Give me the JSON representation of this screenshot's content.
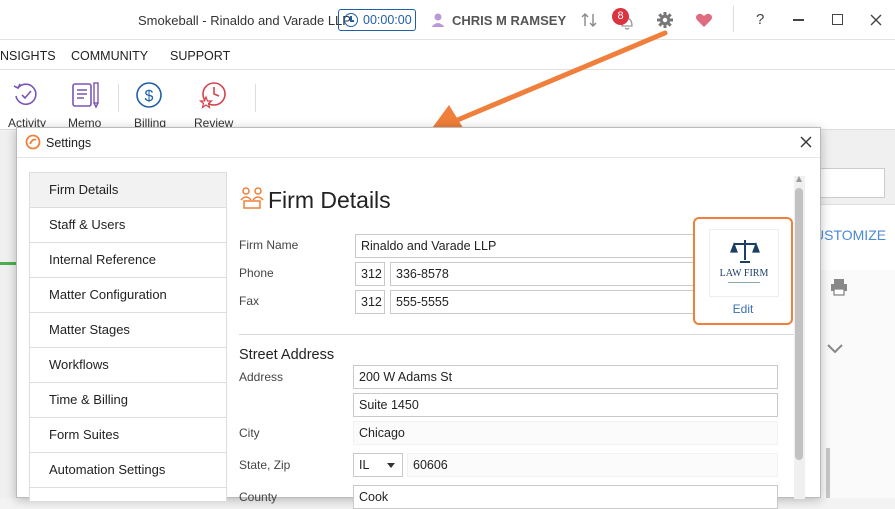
{
  "app": {
    "title": "Smokeball  - Rinaldo and Varade LLP",
    "timer": "00:00:00",
    "user": "CHRIS M RAMSEY",
    "notification_count": "8",
    "help": "?"
  },
  "menu": {
    "items": [
      "NSIGHTS",
      "COMMUNITY",
      "SUPPORT"
    ]
  },
  "ribbon": {
    "items": [
      "Activity",
      "Memo",
      "Billing",
      "Review"
    ]
  },
  "background": {
    "customize": "USTOMIZE"
  },
  "dialog": {
    "title": "Settings",
    "sidebar": [
      "Firm Details",
      "Staff & Users",
      "Internal Reference",
      "Matter Configuration",
      "Matter Stages",
      "Workflows",
      "Time & Billing",
      "Form Suites",
      "Automation Settings"
    ],
    "heading": "Firm Details",
    "labels": {
      "firm_name": "Firm Name",
      "phone": "Phone",
      "fax": "Fax",
      "street_address": "Street Address",
      "address": "Address",
      "city": "City",
      "state_zip": "State, Zip",
      "county": "County"
    },
    "values": {
      "firm_name": "Rinaldo and Varade LLP",
      "phone_area": "312",
      "phone_number": "336-8578",
      "fax_area": "312",
      "fax_number": "555-5555",
      "address1": "200 W Adams St",
      "address2": "Suite 1450",
      "city": "Chicago",
      "state": "IL",
      "zip": "60606",
      "county": "Cook"
    },
    "logo": {
      "text": "LAW FIRM",
      "edit": "Edit"
    }
  },
  "colors": {
    "accent_blue": "#1f5fa8",
    "highlight_orange": "#ef7f3a",
    "logo_navy": "#1c3f66",
    "heart": "#e06a80"
  }
}
